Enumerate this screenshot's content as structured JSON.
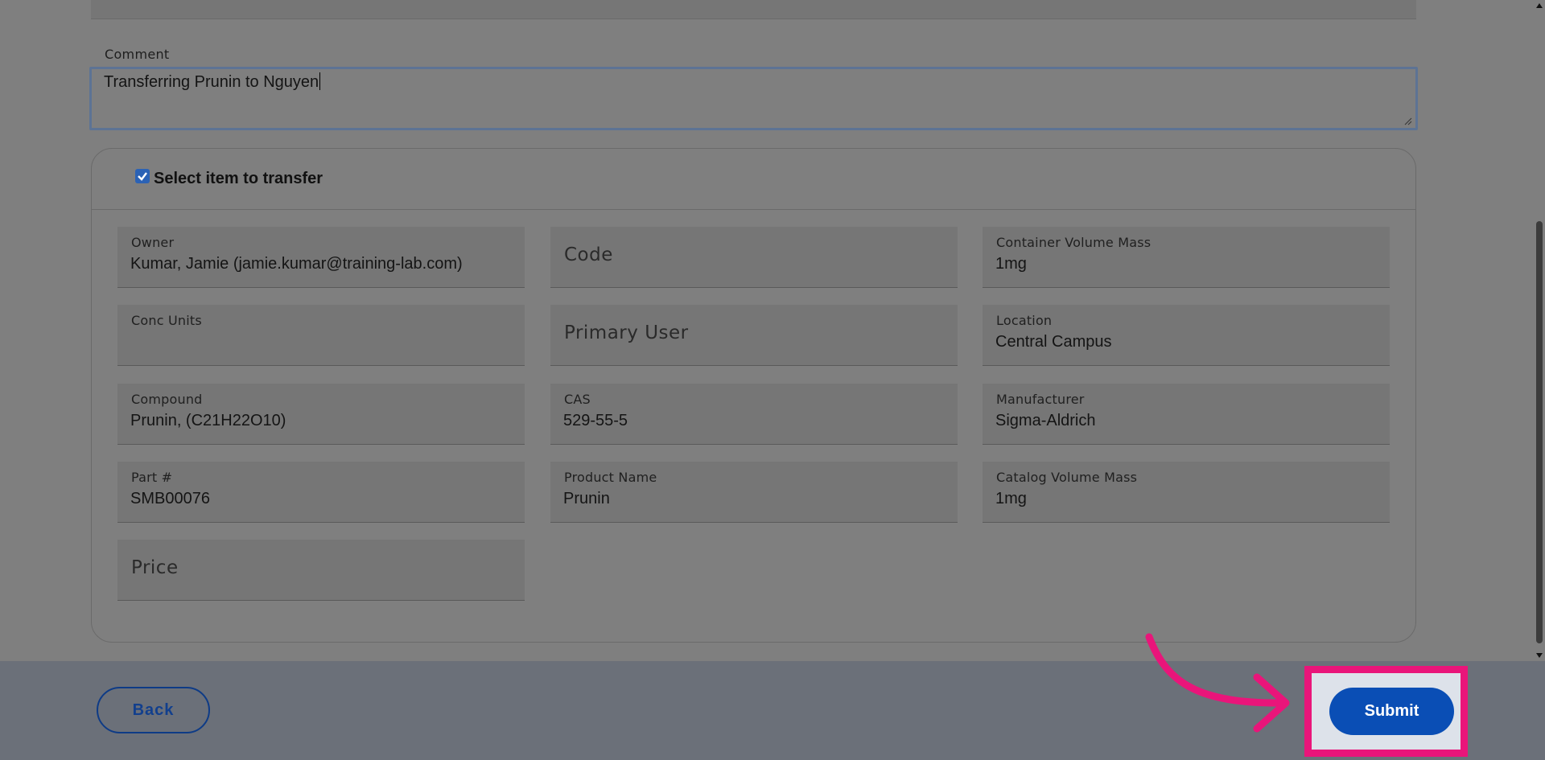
{
  "comment": {
    "label": "Comment",
    "value": "Transferring Prunin to Nguyen"
  },
  "item": {
    "checkbox_checked": true,
    "title": "Select item to transfer",
    "fields": [
      {
        "label": "Owner",
        "value": "Kumar, Jamie (jamie.kumar@training-lab.com)"
      },
      {
        "placeholder": "Code"
      },
      {
        "label": "Container Volume Mass",
        "value": "1mg"
      },
      {
        "label": "Conc Units",
        "value": ""
      },
      {
        "placeholder": "Primary User"
      },
      {
        "label": "Location",
        "value": "Central Campus"
      },
      {
        "label": "Compound",
        "value": "Prunin, (C21H22O10)"
      },
      {
        "label": "CAS",
        "value": "529-55-5"
      },
      {
        "label": "Manufacturer",
        "value": "Sigma-Aldrich"
      },
      {
        "label": "Part #",
        "value": "SMB00076"
      },
      {
        "label": "Product Name",
        "value": "Prunin"
      },
      {
        "label": "Catalog Volume Mass",
        "value": "1mg"
      },
      {
        "placeholder": "Price"
      }
    ]
  },
  "footer": {
    "back_label": "Back",
    "submit_label": "Submit"
  },
  "colors": {
    "highlight": "#e9157a",
    "primary": "#0a4eb5"
  },
  "icons": {
    "checkbox": "checkmark-icon",
    "annotation": "curved-arrow-icon"
  }
}
